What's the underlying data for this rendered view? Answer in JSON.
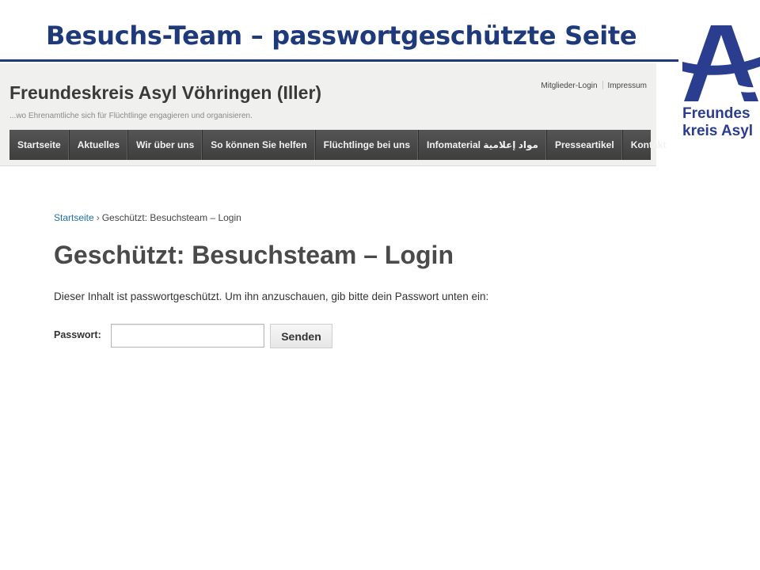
{
  "slide": {
    "title": "Besuchs-Team – passwortgeschützte Seite"
  },
  "logo": {
    "line1": "Freundes",
    "line2": "kreis Asyl",
    "color": "#2a3d8f"
  },
  "site": {
    "name": "Freundeskreis Asyl Vöhringen (Iller)",
    "tagline": "...wo Ehrenamtliche sich für Flüchtlinge engagieren und organisieren.",
    "top_links": [
      "Mitglieder-Login",
      "Impressum"
    ],
    "nav": [
      "Startseite",
      "Aktuelles",
      "Wir über uns",
      "So können Sie helfen",
      "Flüchtlinge bei uns",
      "Infomaterial مواد إعلامية",
      "Presseartikel",
      "Kontakt"
    ]
  },
  "content": {
    "breadcrumb_home": "Startseite",
    "breadcrumb_separator": "›",
    "breadcrumb_current": "Geschützt: Besuchsteam – Login",
    "heading": "Geschützt: Besuchsteam – Login",
    "intro": "Dieser Inhalt ist passwortgeschützt. Um ihn anzuschauen, gib bitte dein Passwort unten ein:",
    "password_label": "Passwort:",
    "password_value": "",
    "submit_label": "Senden"
  },
  "colors": {
    "title_blue": "#1f3a7a",
    "nav_bg": "#4a4a4a",
    "link_blue": "#1e6fb0"
  }
}
